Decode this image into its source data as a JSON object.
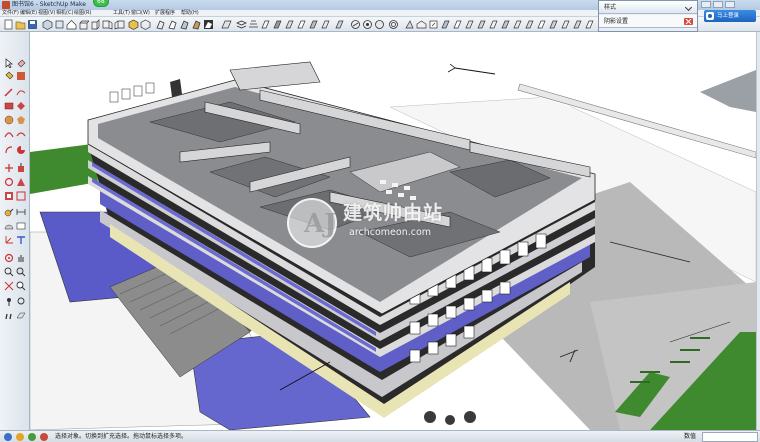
{
  "window": {
    "title": "图书馆6 - SketchUp Make",
    "badge": "68"
  },
  "menu": [
    "文件(F)",
    "编辑(E)",
    "视图(V)",
    "相机(C)",
    "绘图(R)",
    "工具(T)",
    "窗口(W)",
    "扩展程序",
    "帮助(H)"
  ],
  "panels": {
    "panel1_label": "样式",
    "panel2_label": "阴影设置",
    "login_label": "马上登录"
  },
  "watermark": {
    "logo": "AJ",
    "name": "建筑帅由站",
    "url": "archcomeon.com"
  },
  "status": {
    "hint": "选择对象。切换到扩充选择。拖动鼠标选择多项。",
    "measure_label": "数值"
  },
  "colors": {
    "roof": "#8a8c90",
    "wall": "#d9dadc",
    "glass": "#6f6fd0",
    "grass": "#3f8a2e",
    "ground": "#c2c2c2"
  }
}
